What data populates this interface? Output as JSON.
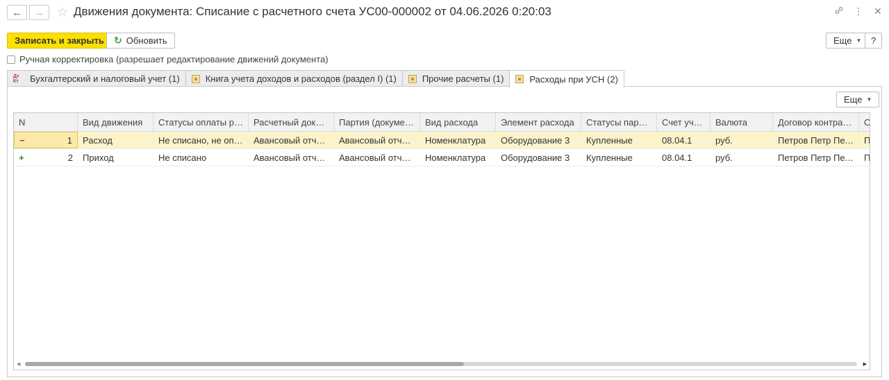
{
  "window": {
    "title": "Движения документа: Списание с расчетного счета УС00-000002 от 04.06.2026 0:20:03",
    "back_icon": "arrow-left-icon",
    "forward_icon": "arrow-right-icon",
    "favorite_icon": "star-icon"
  },
  "toolbar": {
    "save_close_label": "Записать и закрыть",
    "refresh_label": "Обновить",
    "more_label": "Еще",
    "help_label": "?"
  },
  "manual_correction": {
    "label": "Ручная корректировка (разрешает редактирование движений документа)"
  },
  "tabs": [
    {
      "label": "Бухгалтерский и налоговый учет (1)",
      "icon": "dt-kt-icon"
    },
    {
      "label": "Книга учета доходов и расходов (раздел I) (1)",
      "icon": "register-icon"
    },
    {
      "label": "Прочие расчеты (1)",
      "icon": "register-icon"
    },
    {
      "label": "Расходы при УСН (2)",
      "icon": "register-icon",
      "active": true
    }
  ],
  "panel": {
    "more_label": "Еще"
  },
  "table": {
    "columns": [
      "N",
      "Вид движения",
      "Статусы оплаты рас...",
      "Расчетный докум...",
      "Партия (документ...",
      "Вид расхода",
      "Элемент расхода",
      "Статусы парти...",
      "Счет учета",
      "Валюта",
      "Договор контраге...",
      "О"
    ],
    "rows": [
      {
        "sign": "−",
        "n": "1",
        "cells": [
          "Расход",
          "Не списано, не опла...",
          "Авансовый отчет ...",
          "Авансовый отчет ...",
          "Номенклатура",
          "Оборудование 3",
          "Купленные",
          "08.04.1",
          "руб.",
          "Петров Петр Петр...",
          "П"
        ]
      },
      {
        "sign": "+",
        "n": "2",
        "cells": [
          "Приход",
          "Не списано",
          "Авансовый отчет ...",
          "Авансовый отчет ...",
          "Номенклатура",
          "Оборудование 3",
          "Купленные",
          "08.04.1",
          "руб.",
          "Петров Петр Петр...",
          "П"
        ]
      }
    ]
  }
}
